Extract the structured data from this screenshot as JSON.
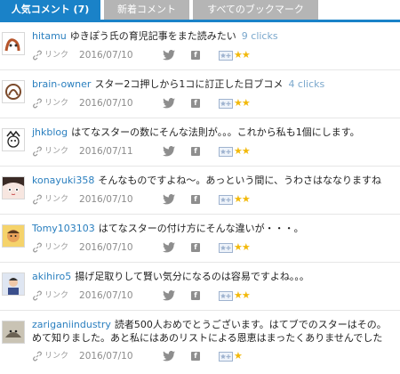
{
  "tabs": [
    {
      "label": "人気コメント (7)",
      "active": true
    },
    {
      "label": "新着コメント",
      "active": false
    },
    {
      "label": "すべてのブックマーク",
      "active": false
    }
  ],
  "meta": {
    "link_label": "リンク",
    "twitter_icon": "twitter-icon",
    "facebook_icon": "facebook-icon",
    "add_star_icon": "add-star-icon",
    "star_color": "#f2b90a"
  },
  "comments": [
    {
      "user": "hitamu",
      "text": "ゆきぽう氏の育児記事をまた読みたい",
      "clicks": "9 clicks",
      "date": "2016/07/10",
      "stars": "★★"
    },
    {
      "user": "brain-owner",
      "text": "スター2コ押しから1コに訂正した日ブコメ",
      "clicks": "4 clicks",
      "date": "2016/07/10",
      "stars": "★★"
    },
    {
      "user": "jhkblog",
      "text": "はてなスターの数にそんな法則が。。。これから私も1個にします。",
      "clicks": "",
      "date": "2016/07/11",
      "stars": "★★"
    },
    {
      "user": "konayuki358",
      "text": "そんなものですよね〜。あっという間に、うわさはななりますね",
      "clicks": "",
      "date": "2016/07/10",
      "stars": "★★"
    },
    {
      "user": "Tomy103103",
      "text": "はてなスターの付け方にそんな違いが・・・。",
      "clicks": "",
      "date": "2016/07/10",
      "stars": "★★"
    },
    {
      "user": "akihiro5",
      "text": "揚げ足取りして賢い気分になるのは容易ですよね。。。",
      "clicks": "",
      "date": "2016/07/10",
      "stars": "★★"
    },
    {
      "user": "zariganiindustry",
      "text": "読者500人おめでとうございます。はてブでのスターはその。",
      "text2": "めて知りました。あと私にはあのリストによる恩恵はまったくありませんでした",
      "clicks": "",
      "date": "2016/07/10",
      "stars": "★"
    }
  ]
}
